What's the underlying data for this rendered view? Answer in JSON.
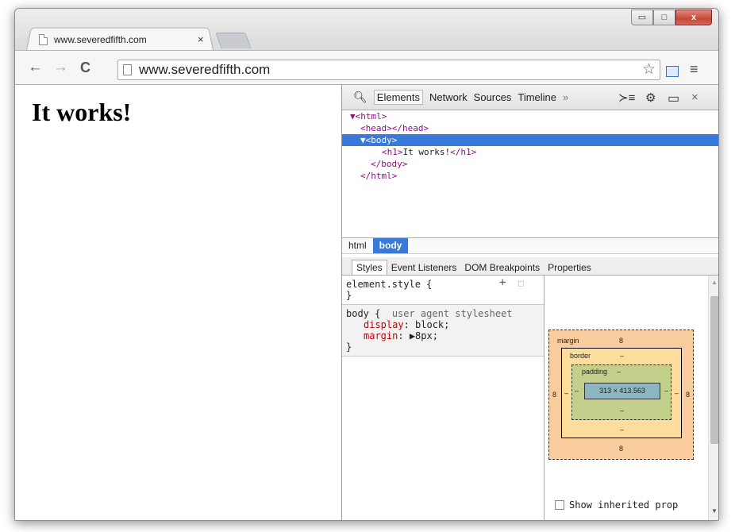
{
  "tab": {
    "title": "www.severedfifth.com",
    "close": "×"
  },
  "window_controls": {
    "minimize": "▭",
    "maximize": "□",
    "close": "x"
  },
  "nav": {
    "back": "←",
    "forward": "→",
    "reload": "C"
  },
  "address_bar": {
    "value": "www.severedfifth.com"
  },
  "page": {
    "heading": "It works!"
  },
  "devtools": {
    "tabs": [
      "Elements",
      "Network",
      "Sources",
      "Timeline"
    ],
    "more": "»",
    "close": "×",
    "dom": [
      {
        "text": "▼<html>",
        "indent": 0
      },
      {
        "text": "<head></head>",
        "indent": 2
      },
      {
        "text": "▼<body>",
        "indent": 1,
        "selected": true
      },
      {
        "text": "<h1>It works!</h1>",
        "indent": 3
      },
      {
        "text": "</body>",
        "indent": 2
      },
      {
        "text": "</html>",
        "indent": 1
      }
    ],
    "breadcrumbs": [
      "html",
      "body"
    ],
    "subtabs": [
      "Styles",
      "Event Listeners",
      "DOM Breakpoints",
      "Properties"
    ],
    "styles": {
      "element_selector": "element.style {",
      "close_brace": "}",
      "body_selector": "body {",
      "origin": "user agent stylesheet",
      "props": [
        {
          "key": "display",
          "value": "block;"
        },
        {
          "key": "margin",
          "value": "▶8px;"
        }
      ]
    },
    "metrics": {
      "margin_label": "margin",
      "margin": "8",
      "border_label": "border",
      "border": "–",
      "padding_label": "padding",
      "padding": "–",
      "content": "313 × 413.563"
    },
    "show_inherited": "Show inherited prop"
  }
}
